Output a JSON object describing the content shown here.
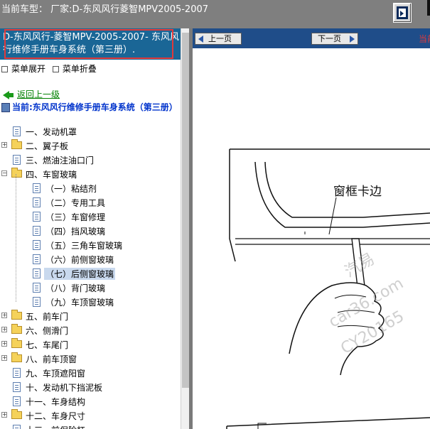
{
  "topbar": {
    "title": "当前车型：  厂家:D-东风风行菱智MPV2005-2007"
  },
  "left": {
    "header_text": "D-东风风行-菱智MPV-2005-2007- 东风风行维修手册车身系统（第三册）.",
    "menu_expand": "菜单展开",
    "menu_collapse": "菜单折叠",
    "back_label": "返回上一级",
    "current_label": "当前:东风风行维修手册车身系统（第三册）",
    "tree": [
      {
        "label": "一、发动机罩",
        "type": "doc",
        "level": 0
      },
      {
        "label": "二、翼子板",
        "type": "folder",
        "level": 0
      },
      {
        "label": "三、燃油注油口门",
        "type": "doc",
        "level": 0
      },
      {
        "label": "四、车窗玻璃",
        "type": "folder-open",
        "level": 0
      },
      {
        "label": "（一）粘结剂",
        "type": "doc",
        "level": 1
      },
      {
        "label": "（二）专用工具",
        "type": "doc",
        "level": 1
      },
      {
        "label": "（三）车窗修理",
        "type": "doc",
        "level": 1
      },
      {
        "label": "（四）挡风玻璃",
        "type": "doc",
        "level": 1
      },
      {
        "label": "（五）三角车窗玻璃",
        "type": "doc",
        "level": 1
      },
      {
        "label": "（六）前侧窗玻璃",
        "type": "doc",
        "level": 1
      },
      {
        "label": "（七）后侧窗玻璃",
        "type": "doc",
        "level": 1,
        "selected": true
      },
      {
        "label": "（八）背门玻璃",
        "type": "doc",
        "level": 1
      },
      {
        "label": "（九）车顶窗玻璃",
        "type": "doc",
        "level": 1
      },
      {
        "label": "五、前车门",
        "type": "folder",
        "level": 0
      },
      {
        "label": "六、侧滑门",
        "type": "folder",
        "level": 0
      },
      {
        "label": "七、车尾门",
        "type": "folder",
        "level": 0
      },
      {
        "label": "八、前车顶窗",
        "type": "folder",
        "level": 0
      },
      {
        "label": "九、车顶遮阳窗",
        "type": "doc",
        "level": 0
      },
      {
        "label": "十、发动机下挡泥板",
        "type": "doc",
        "level": 0
      },
      {
        "label": "十一、车身结构",
        "type": "doc",
        "level": 0
      },
      {
        "label": "十二、车身尺寸",
        "type": "folder",
        "level": 0
      },
      {
        "label": "十三、前保险杠",
        "type": "doc",
        "level": 0
      }
    ]
  },
  "right": {
    "prev_label": "上一页",
    "next_label": "下一页",
    "current_text": "当前",
    "figure_callout": "窗框卡边",
    "watermark_1": "汽易",
    "watermark_2": "car36.com",
    "watermark_3": "CY20165"
  },
  "colors": {
    "topbar": "#7f7f7f",
    "left_header": "#1a6696",
    "right_header": "#1f4d89",
    "highlight_box": "#e23a3a",
    "current_link": "#0033cc",
    "back_link": "#008000"
  }
}
